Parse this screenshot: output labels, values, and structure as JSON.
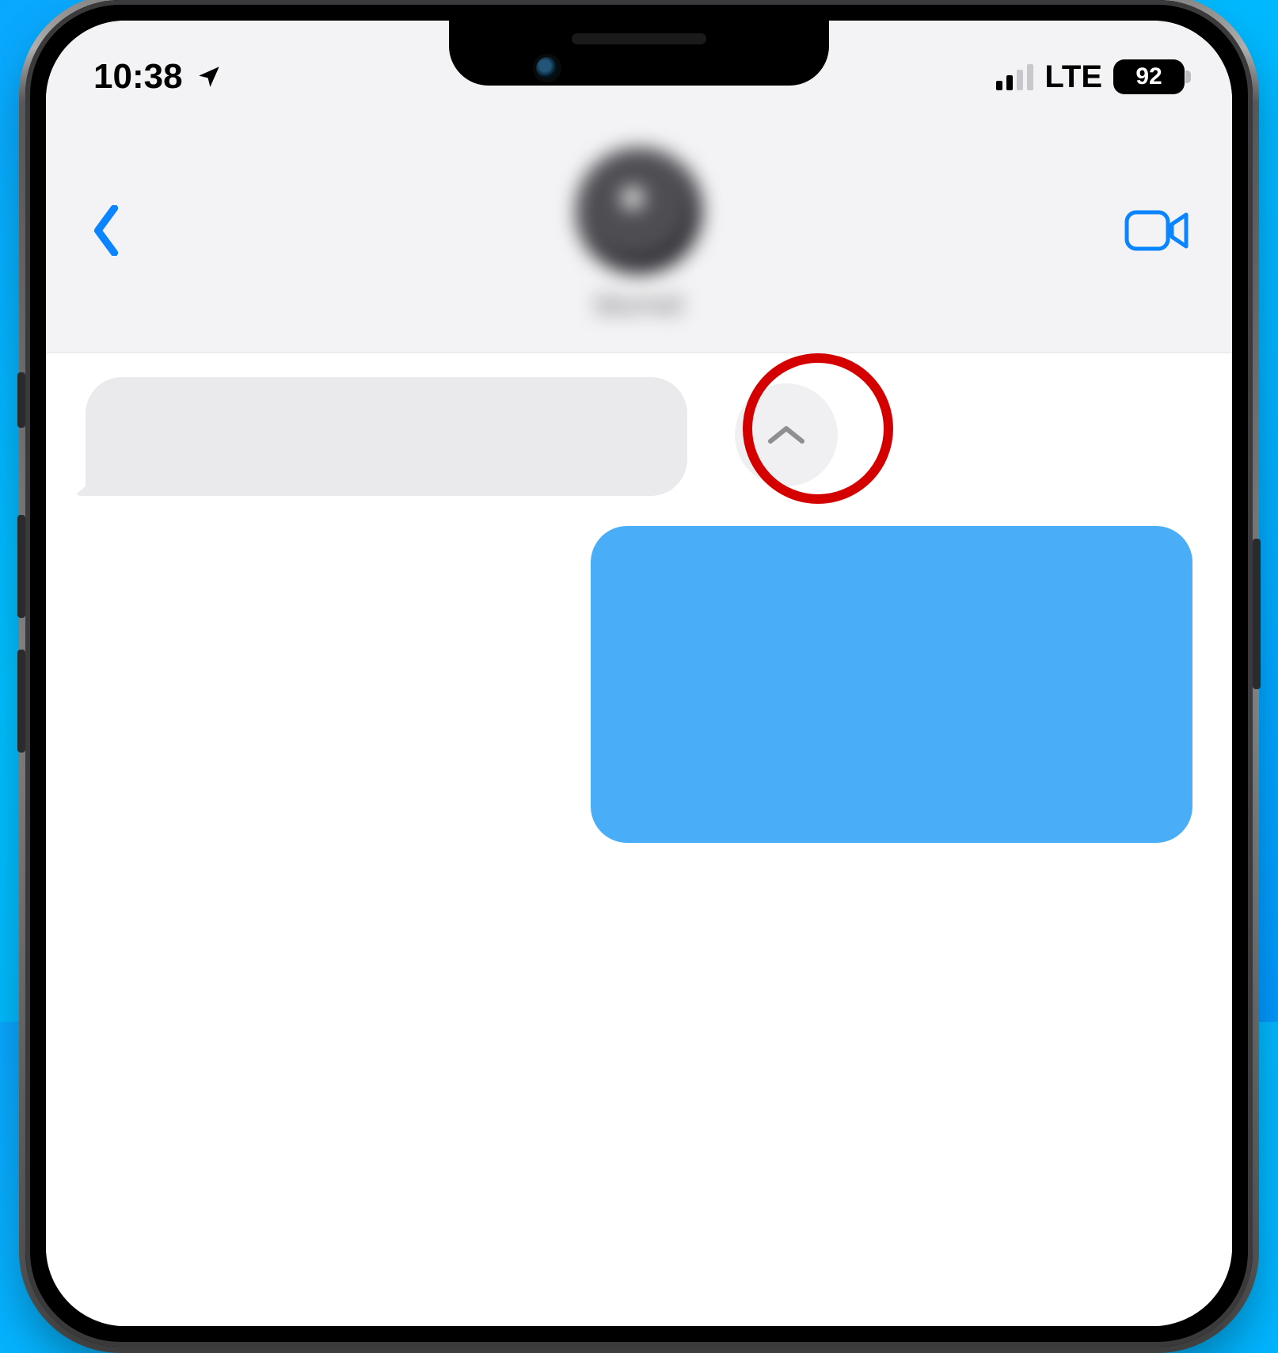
{
  "status": {
    "time": "10:38",
    "network_label": "LTE",
    "battery_percent": "92"
  },
  "colors": {
    "accent_blue": "#0a84ff",
    "bubble_out": "#49aef7",
    "bubble_in": "#eaeaec",
    "highlight_ring": "#d40000"
  },
  "header": {
    "contact_name": "blurred"
  },
  "icons": {
    "location": "location-arrow",
    "back": "chevron-left",
    "video": "video-camera",
    "scroll_up": "chevron-up"
  },
  "annotation": {
    "highlight_target": "scroll-up-button"
  }
}
